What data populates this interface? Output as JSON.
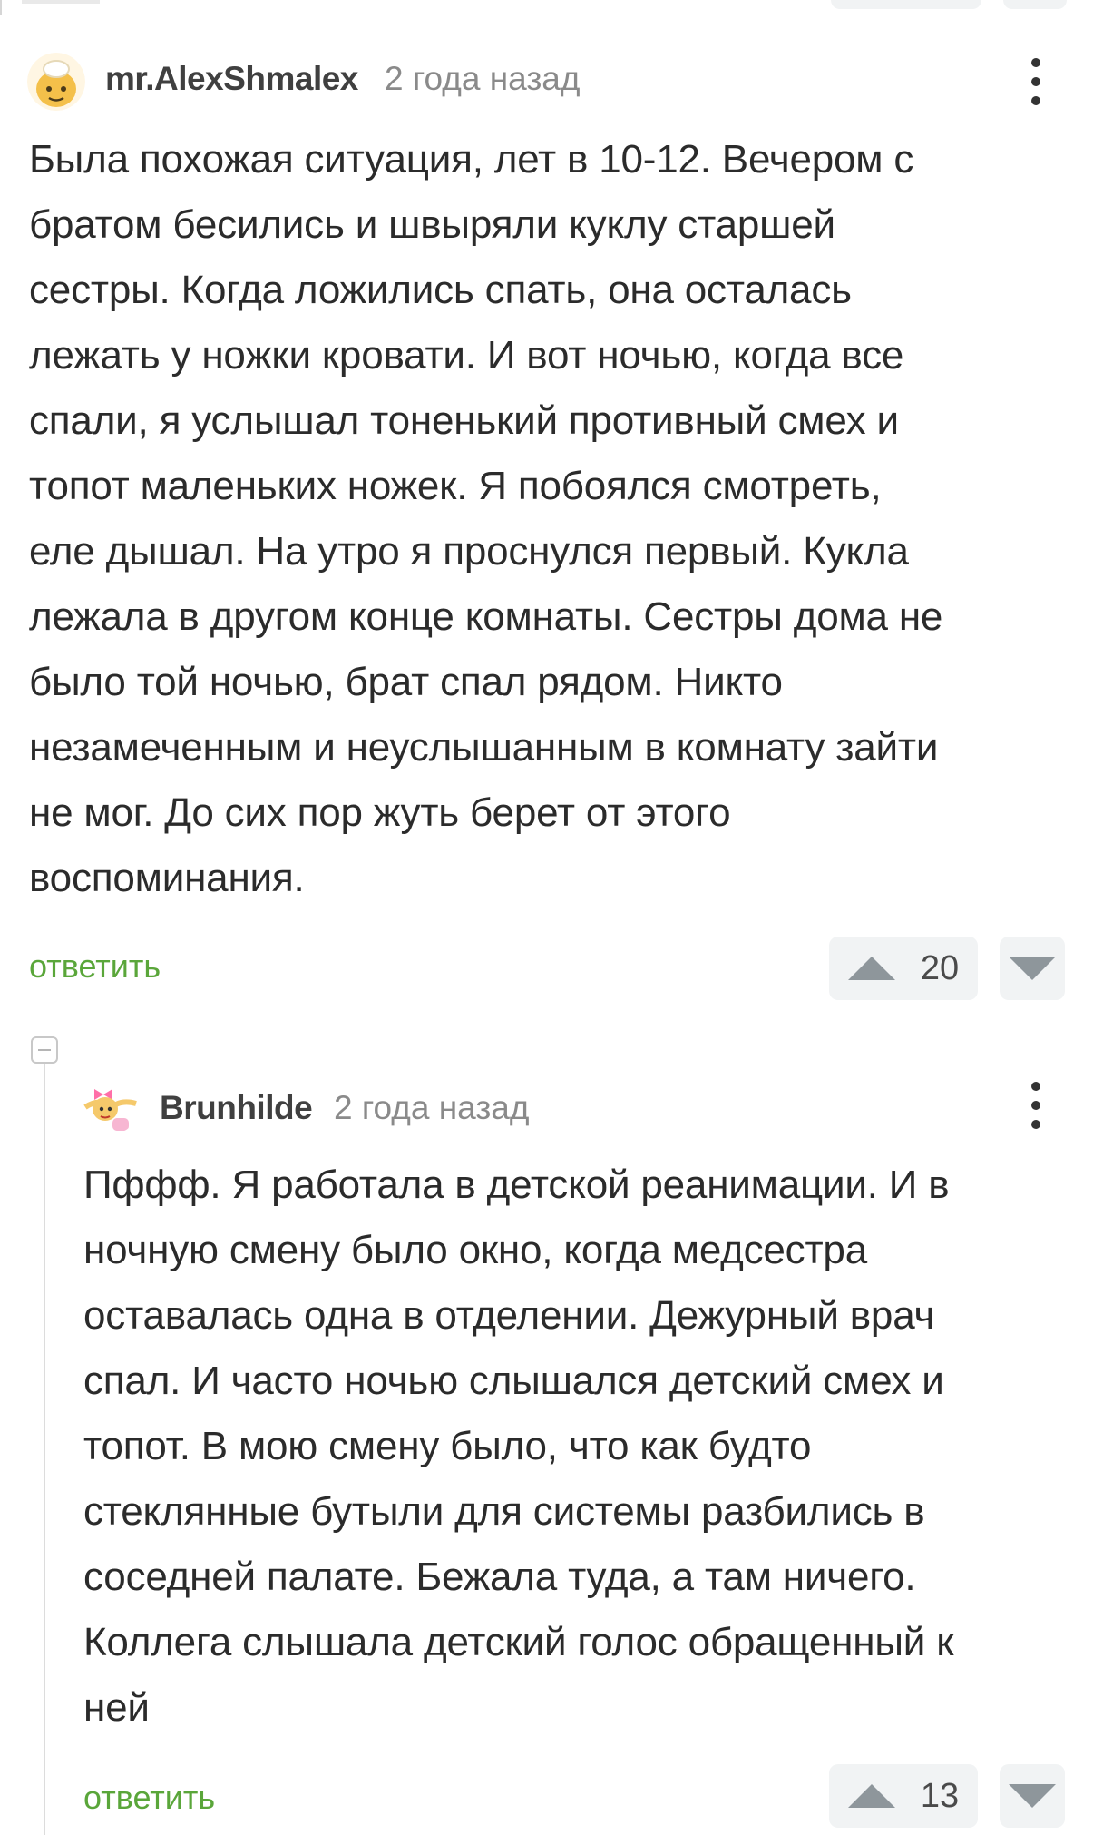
{
  "comments": [
    {
      "username": "mr.AlexShmalex",
      "time": "2 года назад",
      "text": "Была похожая ситуация, лет в 10-12. Вечером с\nбратом бесились и швыряли куклу старшей\nсестры. Когда ложились спать, она осталась\nлежать у ножки кровати. И вот ночью, когда все\nспали, я услышал тоненький противный смех и\nтопот маленьких ножек. Я побоялся смотреть,\nеле дышал. На утро я проснулся первый. Кукла\nлежала в другом конце комнаты. Сестры дома не\nбыло той ночью, брат спал рядом. Никто\nнезамеченным и неуслышанным в комнату зайти\nне мог. До сих пор жуть берет от этого\nвоспоминания.",
      "reply_label": "ответить",
      "rating": "20"
    },
    {
      "username": "Brunhilde",
      "time": "2 года назад",
      "text": "Пффф. Я работала в детской реанимации. И в\nночную смену было окно, когда медсестра\nоставалась одна в отделении. Дежурный врач\nспал. И часто ночью слышался детский смех и\nтопот. В мою смену было, что как будто\nстеклянные бутыли для системы разбились в\nсоседней палате. Бежала туда, а там ничего.\nКоллега слышала детский голос обращенный к\nней",
      "reply_label": "ответить",
      "rating": "13"
    }
  ],
  "colors": {
    "accent_green": "#5aa63a",
    "vote_bg": "#f1f3f4",
    "vote_arrow": "#8e969b"
  },
  "icons": [
    "kebab-menu-icon",
    "upvote-arrow-icon",
    "downvote-arrow-icon",
    "collapse-icon"
  ]
}
